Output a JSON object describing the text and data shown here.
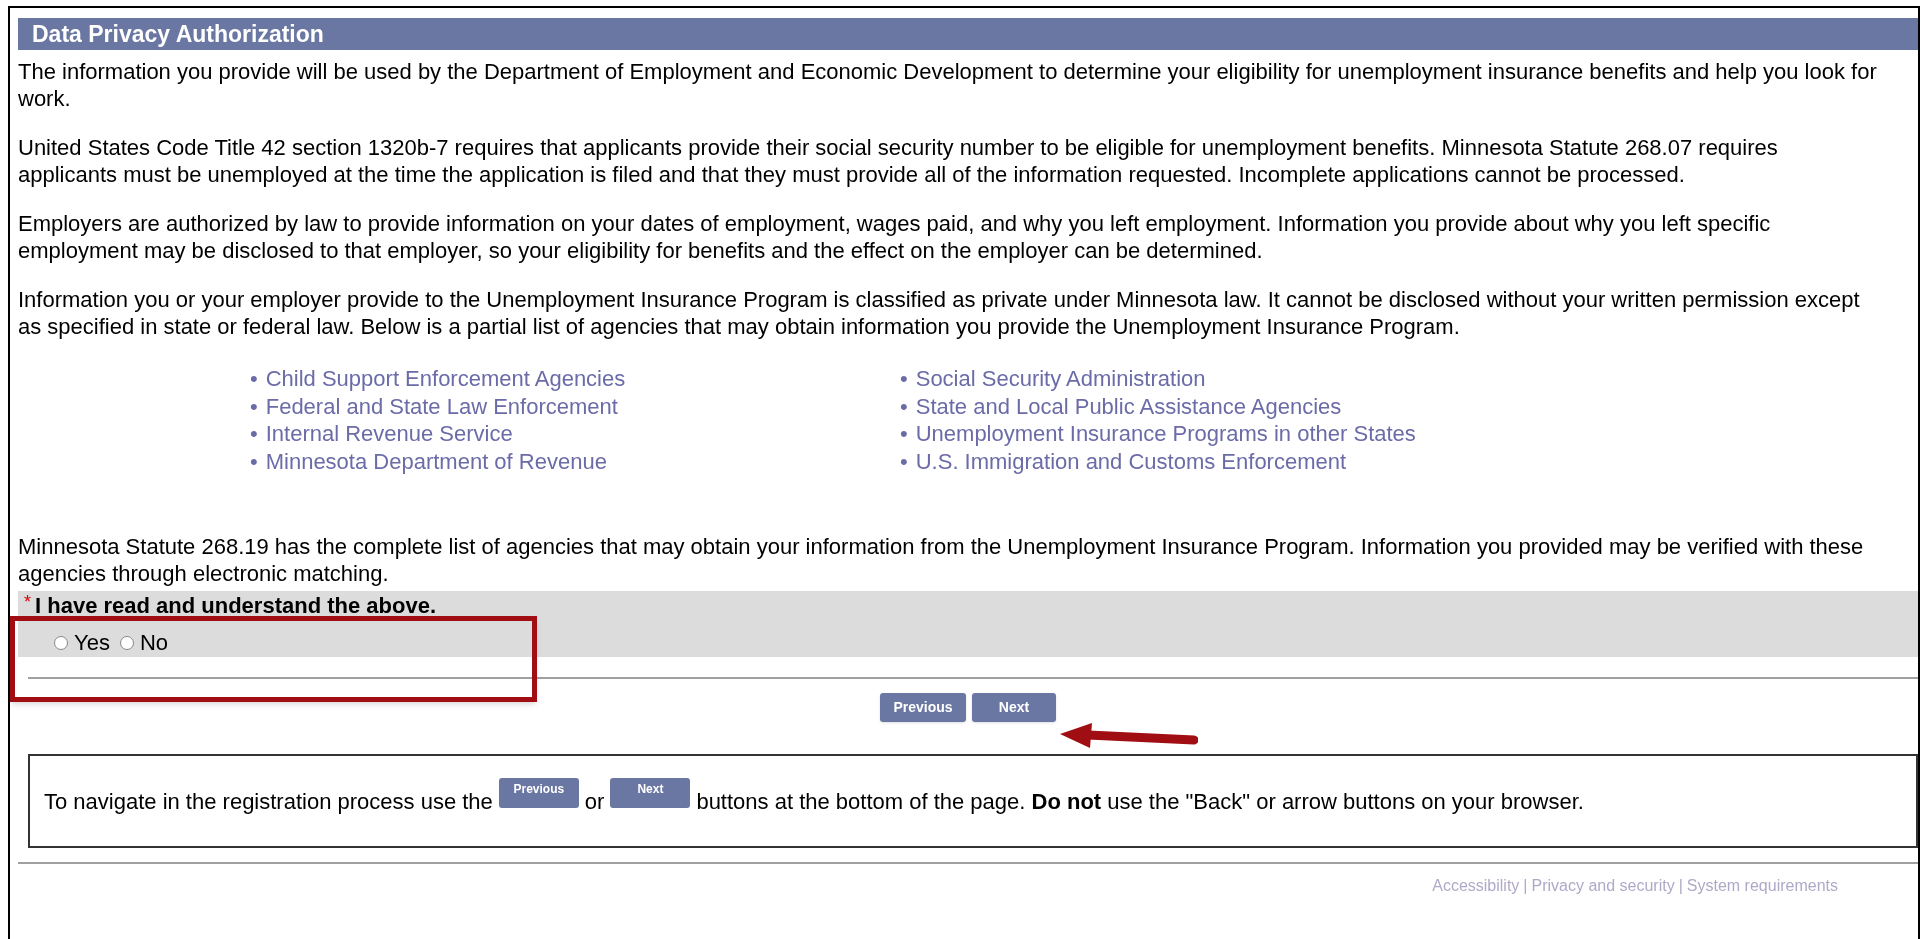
{
  "section_title": "Data Privacy Authorization",
  "paragraphs_top": [
    "The information you provide will be used by the Department of Employment and Economic Development to determine your eligibility for unemployment insurance benefits and help you look for work.",
    "United States Code Title 42 section 1320b-7 requires that applicants provide their social security number to be eligible for unemployment benefits. Minnesota Statute 268.07 requires applicants must be unemployed at the time the application is filed and that they must provide all of the information requested. Incomplete applications cannot be processed.",
    "Employers are authorized by law to provide information on your dates of employment, wages paid, and why you left employment. Information you provide about why you left specific employment may be disclosed to that employer, so your eligibility for benefits and the effect on the employer can be determined.",
    "Information you or your employer provide to the Unemployment Insurance Program is classified as private under Minnesota law. It cannot be disclosed without your written permission except as specified in state or federal law. Below is a partial list of agencies that may obtain information you provide the Unemployment Insurance Program."
  ],
  "agency_columns": [
    [
      "Child Support Enforcement Agencies",
      "Federal and State Law Enforcement",
      "Internal Revenue Service",
      "Minnesota Department of Revenue"
    ],
    [
      "Social Security Administration",
      "State and Local Public Assistance Agencies",
      "Unemployment Insurance Programs in other States",
      "U.S. Immigration and Customs Enforcement"
    ]
  ],
  "bullet": "•",
  "paragraph_bottom": "Minnesota Statute 268.19 has the complete list of agencies that may obtain your information from the Unemployment Insurance Program. Information you provided may be verified with these agencies through electronic matching.",
  "question": {
    "required_mark": "*",
    "label": "I have read and understand the above.",
    "options": [
      {
        "label": "Yes",
        "checked": false
      },
      {
        "label": "No",
        "checked": false
      }
    ]
  },
  "nav_buttons": [
    "Previous",
    "Next"
  ],
  "navigation_note": {
    "before": "To navigate in the registration process use the",
    "button_1": "Previous",
    "between": "or",
    "button_2": "Next",
    "after": "buttons at the bottom of the page. **Do not** use the \"Back\" or arrow buttons on your browser."
  },
  "footer_links": [
    "Accessibility",
    "Privacy and security",
    "System requirements"
  ],
  "footer_separator": "|"
}
